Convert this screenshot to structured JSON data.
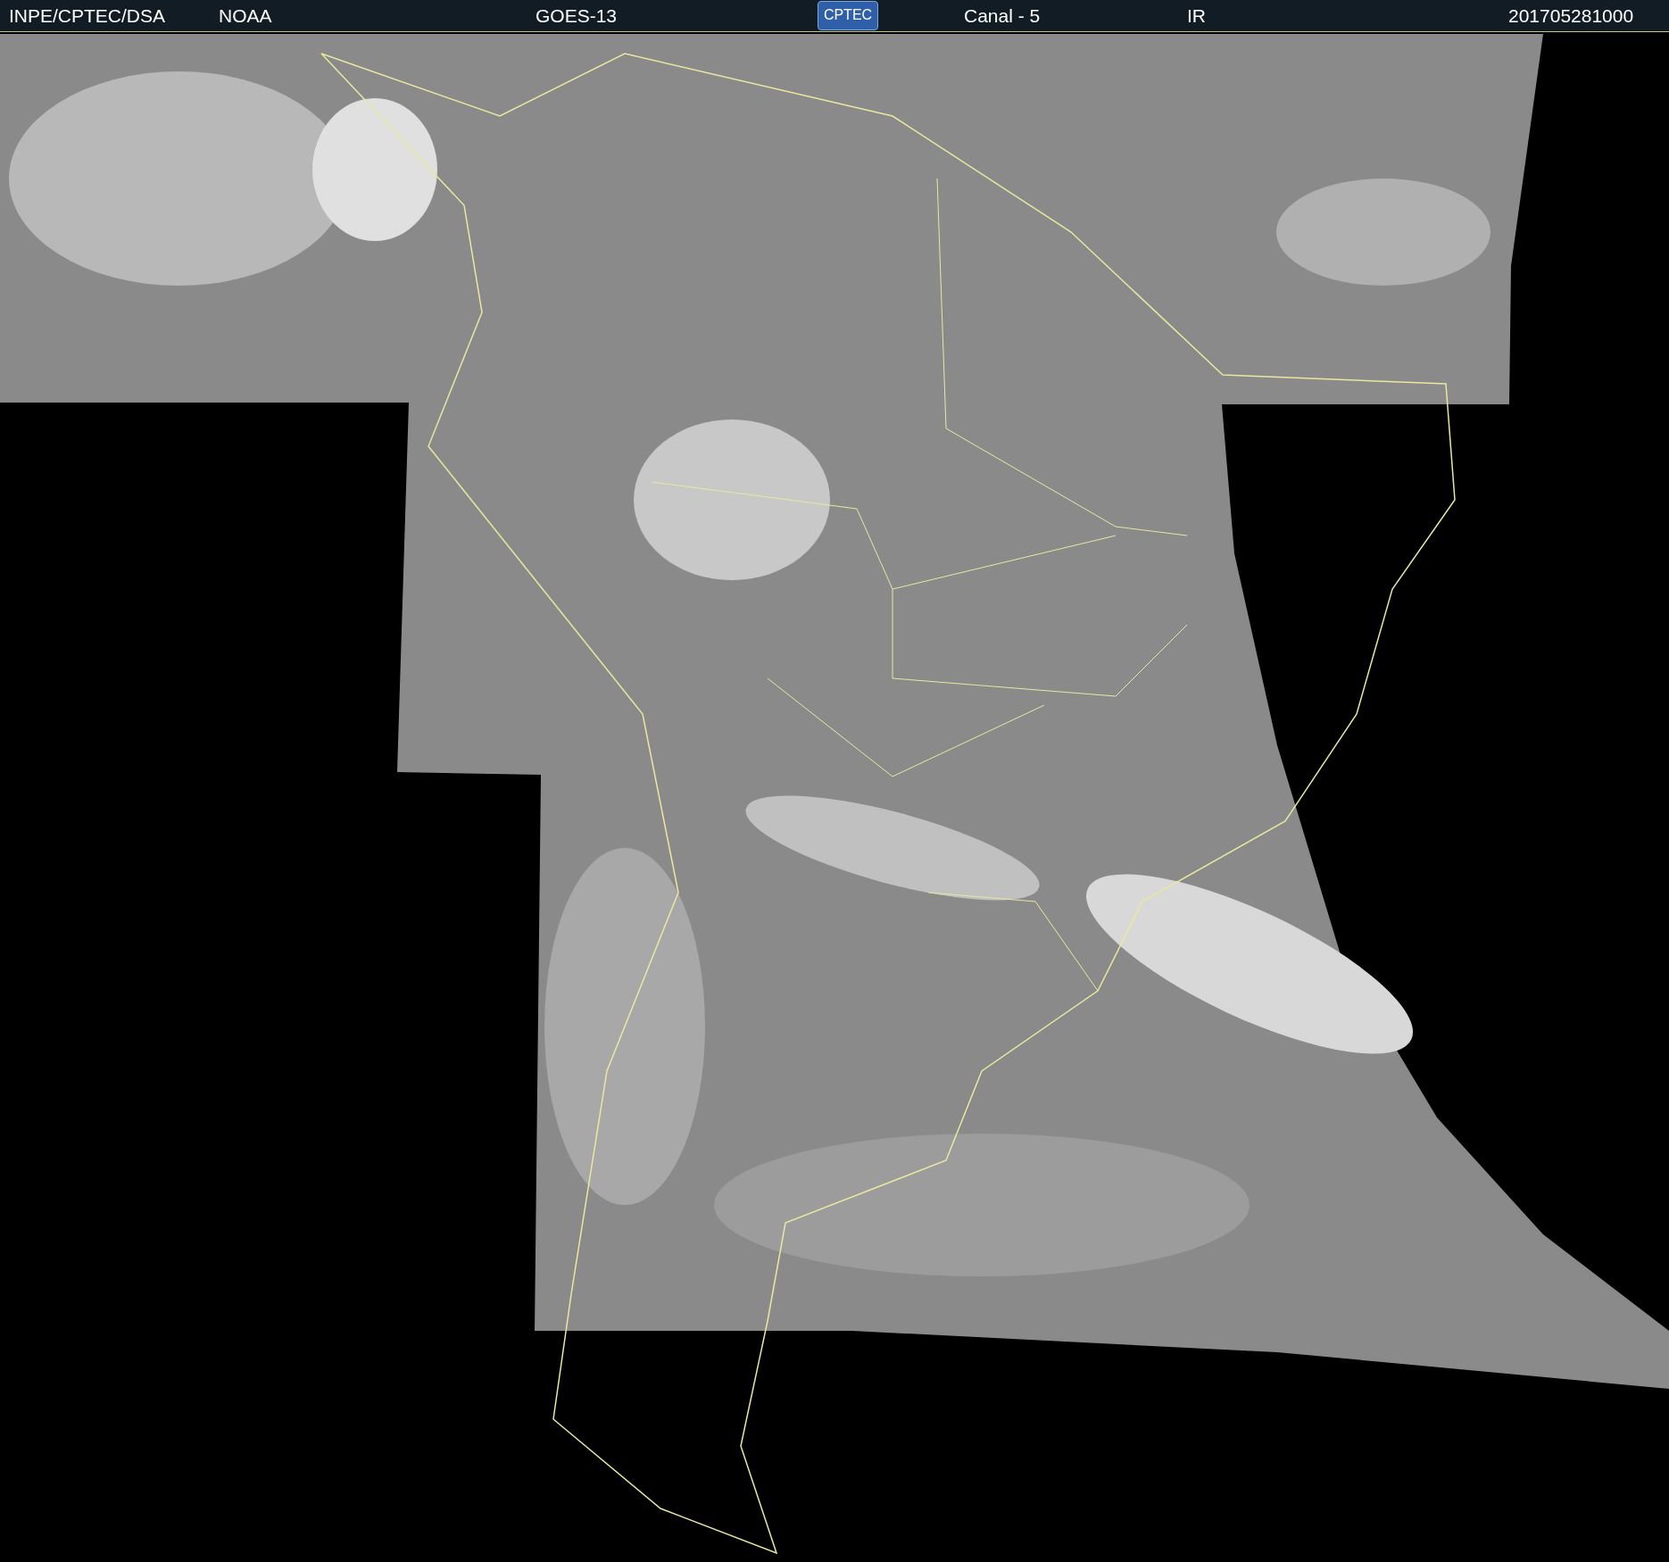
{
  "header": {
    "source": "INPE/CPTEC/DSA",
    "agency": "NOAA",
    "satellite": "GOES-13",
    "logo": "CPTEC",
    "channel": "Canal - 5",
    "band": "IR",
    "timestamp": "201705281000"
  }
}
